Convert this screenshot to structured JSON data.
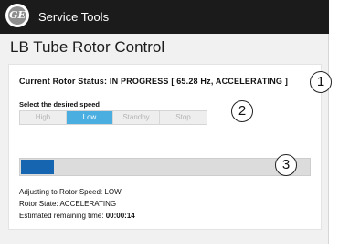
{
  "app": {
    "logo_text": "GE",
    "title": "Service Tools"
  },
  "page": {
    "title": "LB Tube Rotor Control"
  },
  "status": {
    "text": "Current Rotor Status: IN PROGRESS [ 65.28 Hz, ACCELERATING ]"
  },
  "speed": {
    "label": "Select the desired speed",
    "options": [
      "High",
      "Low",
      "Standby",
      "Stop"
    ],
    "selected": "Low"
  },
  "progress": {
    "fraction": 0.12,
    "fill_color": "#1565b0"
  },
  "info": {
    "adjusting": "Adjusting to Rotor Speed: LOW",
    "state": "Rotor State: ACCELERATING",
    "remaining_label": "Estimated remaining time:",
    "remaining_value": "00:00:14"
  },
  "callouts": [
    "1",
    "2",
    "3"
  ],
  "colors": {
    "accent": "#4aaee0",
    "titlebar": "#1b1b1b",
    "progress": "#1565b0"
  }
}
